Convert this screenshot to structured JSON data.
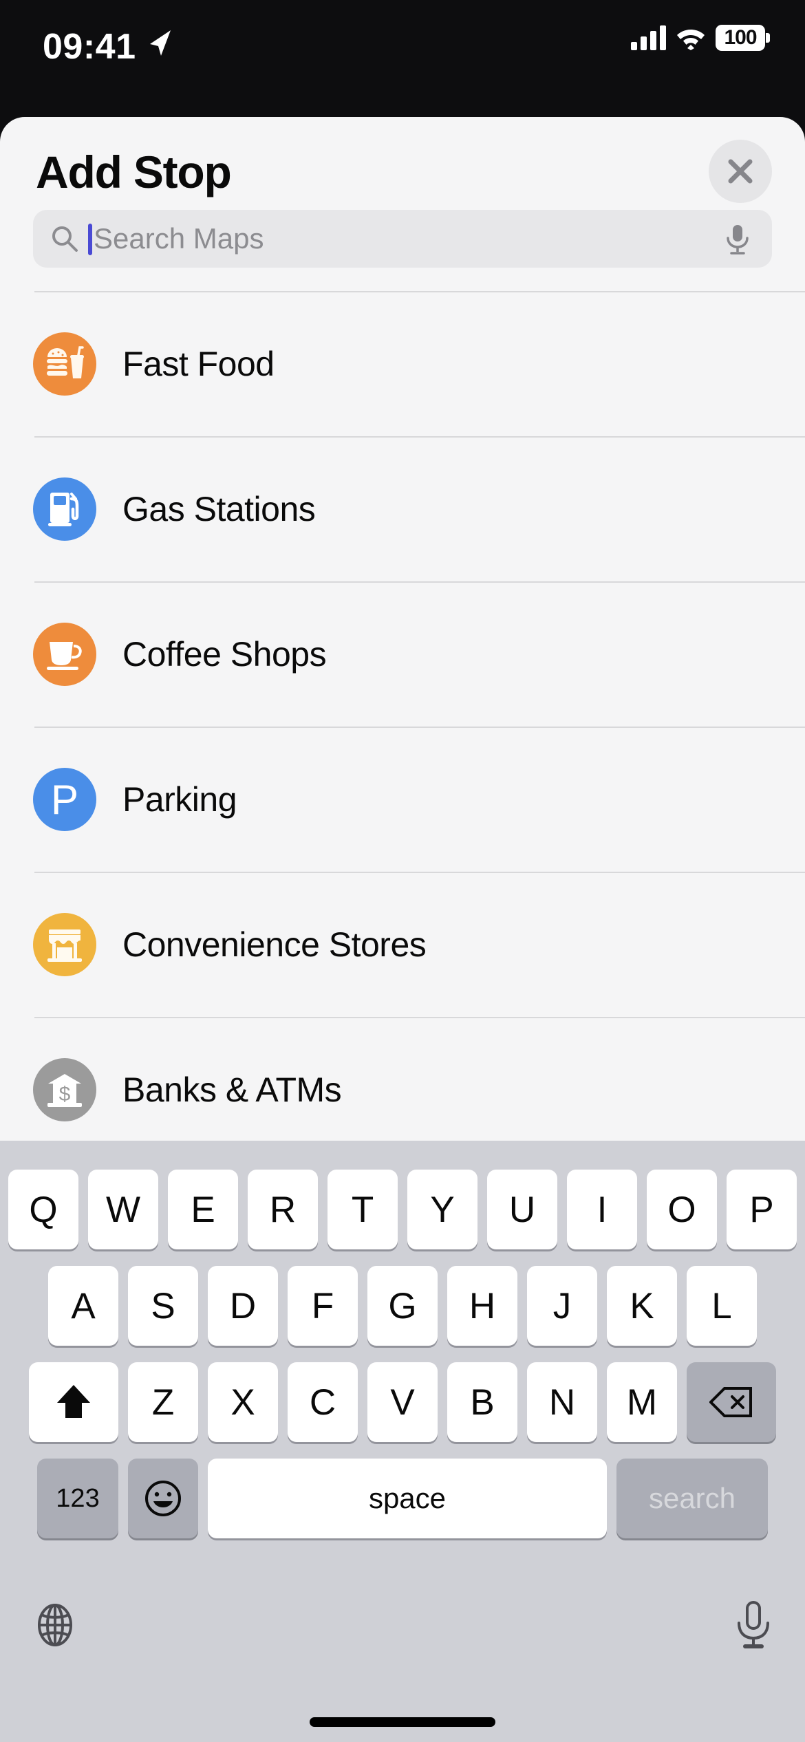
{
  "status_bar": {
    "time": "09:41",
    "location_arrow_icon": "location-arrow-icon",
    "cellular_icon": "cellular-bars-icon",
    "wifi_icon": "wifi-icon",
    "battery_level": "100"
  },
  "sheet": {
    "title": "Add Stop",
    "close_icon": "close-icon"
  },
  "search": {
    "placeholder": "Search Maps",
    "value": "",
    "search_icon": "search-icon",
    "mic_icon": "microphone-icon"
  },
  "categories": [
    {
      "label": "Fast Food",
      "icon": "fast-food-icon",
      "color": "#ee8c3c"
    },
    {
      "label": "Gas Stations",
      "icon": "gas-pump-icon",
      "color": "#4a8ee8"
    },
    {
      "label": "Coffee Shops",
      "icon": "coffee-cup-icon",
      "color": "#ee8c3c"
    },
    {
      "label": "Parking",
      "icon": "parking-p-icon",
      "color": "#4a8ee8"
    },
    {
      "label": "Convenience Stores",
      "icon": "storefront-icon",
      "color": "#f0b43e"
    },
    {
      "label": "Banks & ATMs",
      "icon": "bank-dollar-icon",
      "color": "#9b9b9b"
    }
  ],
  "keyboard": {
    "row1": [
      "Q",
      "W",
      "E",
      "R",
      "T",
      "Y",
      "U",
      "I",
      "O",
      "P"
    ],
    "row2": [
      "A",
      "S",
      "D",
      "F",
      "G",
      "H",
      "J",
      "K",
      "L"
    ],
    "row3": [
      "Z",
      "X",
      "C",
      "V",
      "B",
      "N",
      "M"
    ],
    "shift_icon": "shift-arrow-icon",
    "delete_icon": "backspace-delete-icon",
    "numbers_label": "123",
    "emoji_icon": "emoji-smiley-icon",
    "space_label": "space",
    "return_label": "search",
    "globe_icon": "globe-icon",
    "dictation_icon": "microphone-icon"
  }
}
